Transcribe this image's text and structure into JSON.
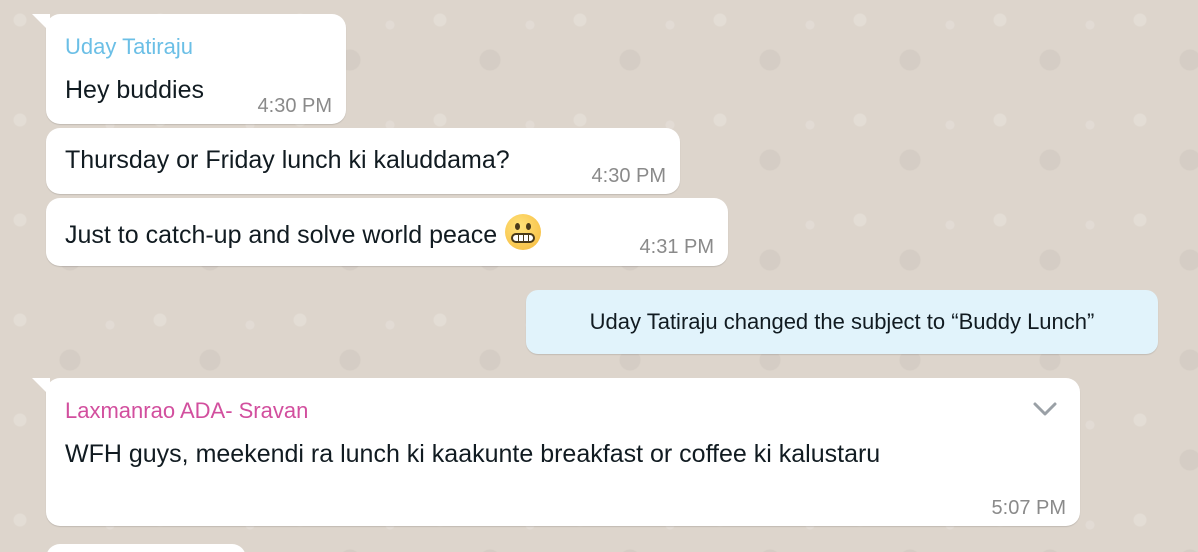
{
  "messages": [
    {
      "sender": "Uday Tatiraju",
      "sender_color": "#6bbfe6",
      "text": "Hey buddies",
      "time": "4:30 PM"
    },
    {
      "text": "Thursday or Friday lunch ki kaluddama?",
      "time": "4:30 PM"
    },
    {
      "text": "Just to catch-up and solve world peace",
      "emoji": "grimacing-face-icon",
      "time": "4:31 PM"
    },
    {
      "sender": "Laxmanrao ADA- Sravan",
      "sender_color": "#d24f9e",
      "text": "WFH guys, meekendi ra lunch ki kaakunte breakfast or coffee ki kalustaru",
      "time": "5:07 PM"
    }
  ],
  "system_message": {
    "text": "Uday Tatiraju changed the subject to “Buddy Lunch”"
  },
  "colors": {
    "bubble": "#ffffff",
    "system_bubble": "#e1f3fb",
    "wallpaper": "#ddd5cc"
  }
}
